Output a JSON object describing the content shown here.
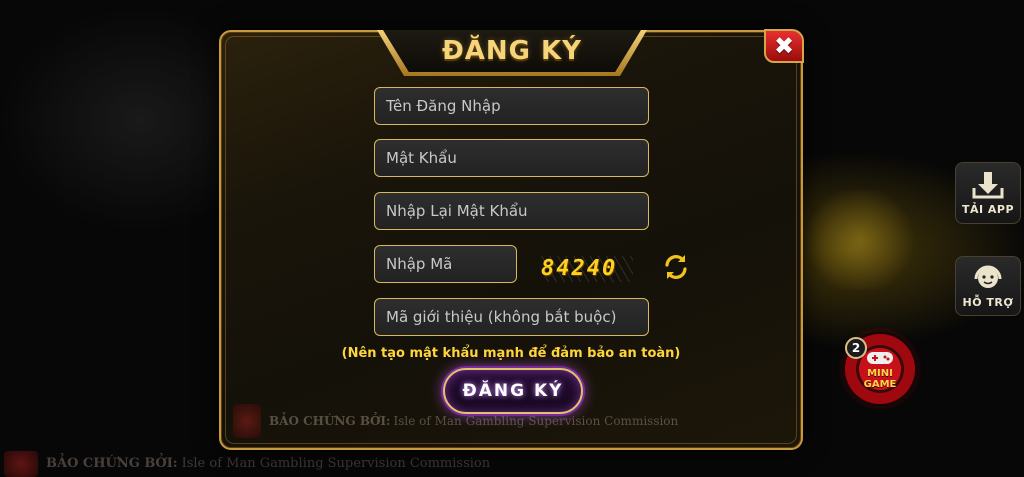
{
  "dialog": {
    "title": "ĐĂNG KÝ",
    "close_label": "✖",
    "fields": {
      "username_placeholder": "Tên Đăng Nhập",
      "password_placeholder": "Mật Khẩu",
      "confirm_password_placeholder": "Nhập Lại Mật Khẩu",
      "code_placeholder": "Nhập Mã",
      "referral_placeholder": "Mã giới thiệu (không bắt buộc)"
    },
    "captcha": "84240",
    "hint": "(Nên tạo mật khẩu mạnh để đảm bảo an toàn)",
    "submit_label": "ĐĂNG KÝ",
    "guarantee_prefix": "BẢO CHỨNG BỞI:",
    "guarantee_text": "Isle of Man Gambling Supervision Commission"
  },
  "side": {
    "download_label": "TẢI APP",
    "support_label": "HỖ TRỢ",
    "mini_game_badge": "2",
    "mini_game_line1": "MINI",
    "mini_game_line2": "GAME"
  },
  "background_footer": {
    "prefix": "BẢO CHỨNG BỞI:",
    "text": "Isle of Man Gambling Supervision Commission"
  },
  "colors": {
    "gold": "#d8b85c",
    "hint_yellow": "#ffd63a",
    "close_red": "#e83030",
    "submit_glow": "#be5af0"
  },
  "icons": [
    "download-icon",
    "support-headset-icon",
    "refresh-icon",
    "close-icon",
    "gamepad-icon",
    "seal-logo"
  ]
}
